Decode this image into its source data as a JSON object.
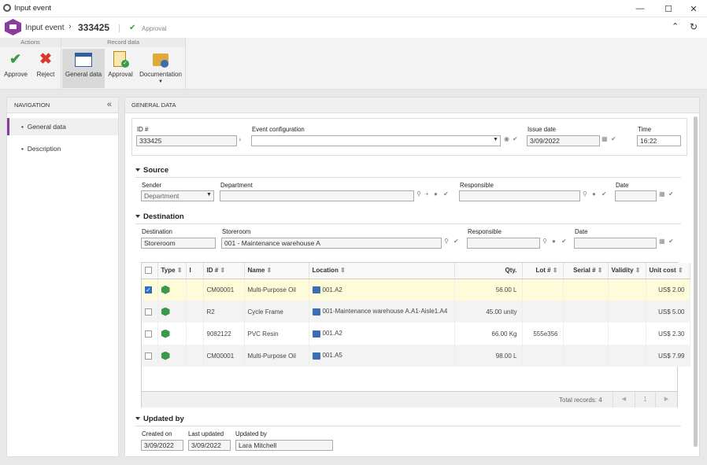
{
  "window": {
    "title": "Input event"
  },
  "header": {
    "app": "Input event",
    "record_id": "333425",
    "status": "Approval"
  },
  "ribbon": {
    "groups": [
      {
        "label": "Actions"
      },
      {
        "label": "Record data"
      }
    ],
    "buttons": {
      "approve": "Approve",
      "reject": "Reject",
      "general": "General data",
      "approval": "Approval",
      "documentation": "Documentation"
    }
  },
  "nav": {
    "title": "NAVIGATION",
    "items": [
      "General data",
      "Description"
    ]
  },
  "content": {
    "title": "GENERAL DATA"
  },
  "form": {
    "id_label": "ID #",
    "id_value": "333425",
    "event_label": "Event configuration",
    "event_value": "",
    "issue_label": "Issue date",
    "issue_value": "3/09/2022",
    "time_label": "Time",
    "time_value": "16:22"
  },
  "source": {
    "title": "Source",
    "sender_label": "Sender",
    "sender_value": "Department",
    "dept_label": "Department",
    "resp_label": "Responsible",
    "date_label": "Date"
  },
  "destination": {
    "title": "Destination",
    "dest_label": "Destination",
    "dest_value": "Storeroom",
    "store_label": "Storeroom",
    "store_value": "001 - Maintenance warehouse A",
    "resp_label": "Responsible",
    "date_label": "Date"
  },
  "grid": {
    "columns": [
      "Type",
      "I",
      "ID #",
      "Name",
      "Location",
      "Qty.",
      "Lot #",
      "Serial #",
      "Validity",
      "Unit cost"
    ],
    "rows": [
      {
        "checked": true,
        "id": "CM00001",
        "name": "Multi-Purpose Oil",
        "location": "001.A2",
        "qty": "56.00 L",
        "lot": "",
        "serial": "",
        "validity": "",
        "cost": "US$ 2.00"
      },
      {
        "checked": false,
        "id": "R2",
        "name": "Cycle Frame",
        "location": "001-Maintenance warehouse A.A1-Aisle1.A4",
        "qty": "45.00 unity",
        "lot": "",
        "serial": "",
        "validity": "",
        "cost": "US$ 5.00"
      },
      {
        "checked": false,
        "id": "9082122",
        "name": "PVC Resin",
        "location": "001.A2",
        "qty": "66.00 Kg",
        "lot": "555e356",
        "serial": "",
        "validity": "",
        "cost": "US$ 2.30"
      },
      {
        "checked": false,
        "id": "CM00001",
        "name": "Multi-Purpose Oil",
        "location": "001.A5",
        "qty": "98.00 L",
        "lot": "",
        "serial": "",
        "validity": "",
        "cost": "US$ 7.99"
      }
    ],
    "total": "Total records: 4",
    "page": "1"
  },
  "updated": {
    "title": "Updated by",
    "created_label": "Created on",
    "created_value": "3/09/2022",
    "last_label": "Last updated",
    "last_value": "3/09/2022",
    "by_label": "Updated by",
    "by_value": "Lara Mitchell"
  }
}
